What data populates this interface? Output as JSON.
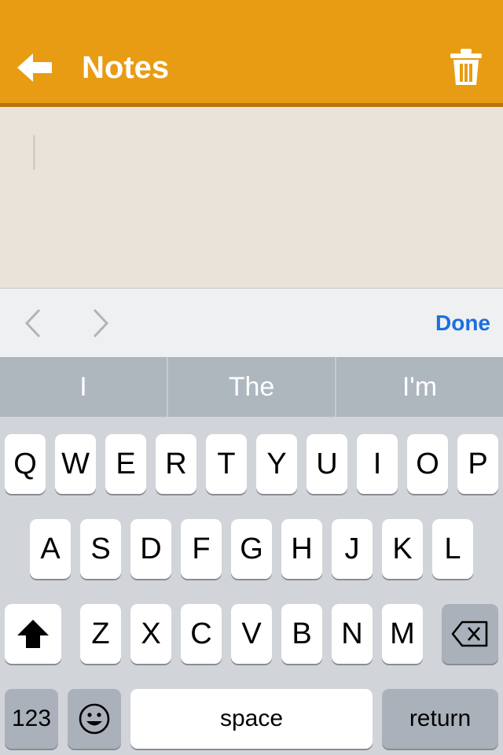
{
  "header": {
    "title": "Notes",
    "back_icon": "arrow-left-icon",
    "trash_icon": "trash-icon",
    "background_color": "#e89c13"
  },
  "note": {
    "text": ""
  },
  "accessory_bar": {
    "prev_icon": "chevron-left-icon",
    "next_icon": "chevron-right-icon",
    "done_label": "Done",
    "done_color": "#1c6fe0"
  },
  "suggestions": [
    "I",
    "The",
    "I'm"
  ],
  "keyboard": {
    "row1": [
      "Q",
      "W",
      "E",
      "R",
      "T",
      "Y",
      "U",
      "I",
      "O",
      "P"
    ],
    "row2": [
      "A",
      "S",
      "D",
      "F",
      "G",
      "H",
      "J",
      "K",
      "L"
    ],
    "row3": [
      "Z",
      "X",
      "C",
      "V",
      "B",
      "N",
      "M"
    ],
    "shift_icon": "shift-arrow-icon",
    "backspace_icon": "backspace-icon",
    "numbers_label": "123",
    "emoji_icon": "emoji-icon",
    "space_label": "space",
    "return_label": "return"
  }
}
